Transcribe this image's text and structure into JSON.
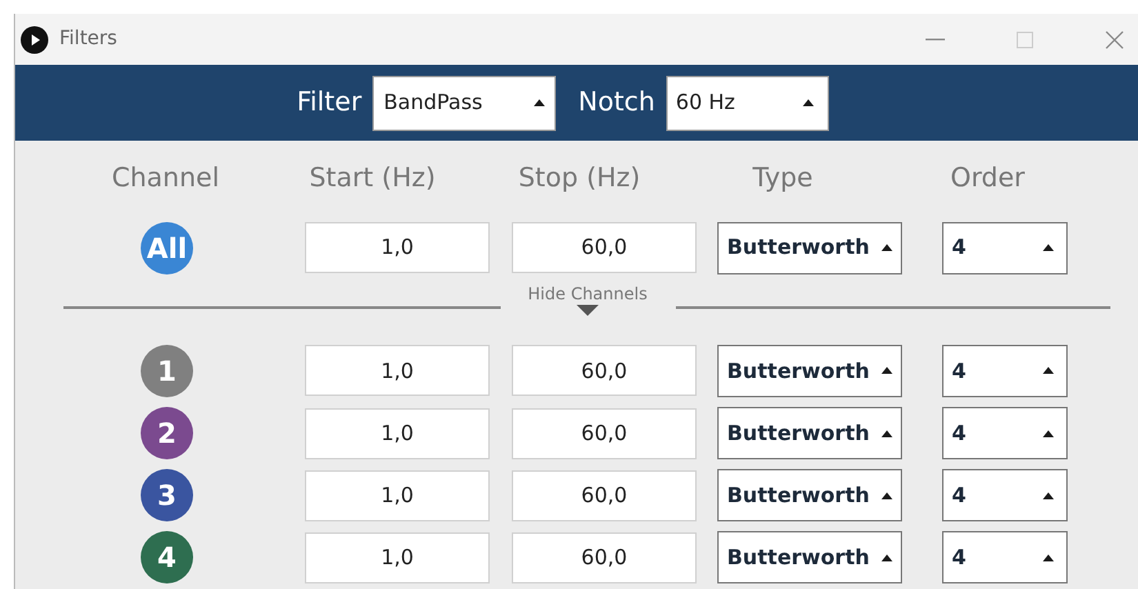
{
  "window": {
    "title": "Filters"
  },
  "toolbar": {
    "filter_label": "Filter",
    "filter_value": "BandPass",
    "notch_label": "Notch",
    "notch_value": "60 Hz"
  },
  "columns": [
    "Channel",
    "Start (Hz)",
    "Stop (Hz)",
    "Type",
    "Order"
  ],
  "all_row": {
    "label": "All",
    "start": "1,0",
    "stop": "60,0",
    "type": "Butterworth",
    "order": "4",
    "color": "#3a86d4"
  },
  "toggle": {
    "label": "Hide Channels",
    "expanded": true
  },
  "channels": [
    {
      "label": "1",
      "start": "1,0",
      "stop": "60,0",
      "type": "Butterworth",
      "order": "4",
      "color": "#808080"
    },
    {
      "label": "2",
      "start": "1,0",
      "stop": "60,0",
      "type": "Butterworth",
      "order": "4",
      "color": "#7b4a8f"
    },
    {
      "label": "3",
      "start": "1,0",
      "stop": "60,0",
      "type": "Butterworth",
      "order": "4",
      "color": "#3a55a0"
    },
    {
      "label": "4",
      "start": "1,0",
      "stop": "60,0",
      "type": "Butterworth",
      "order": "4",
      "color": "#2e6e50"
    }
  ]
}
